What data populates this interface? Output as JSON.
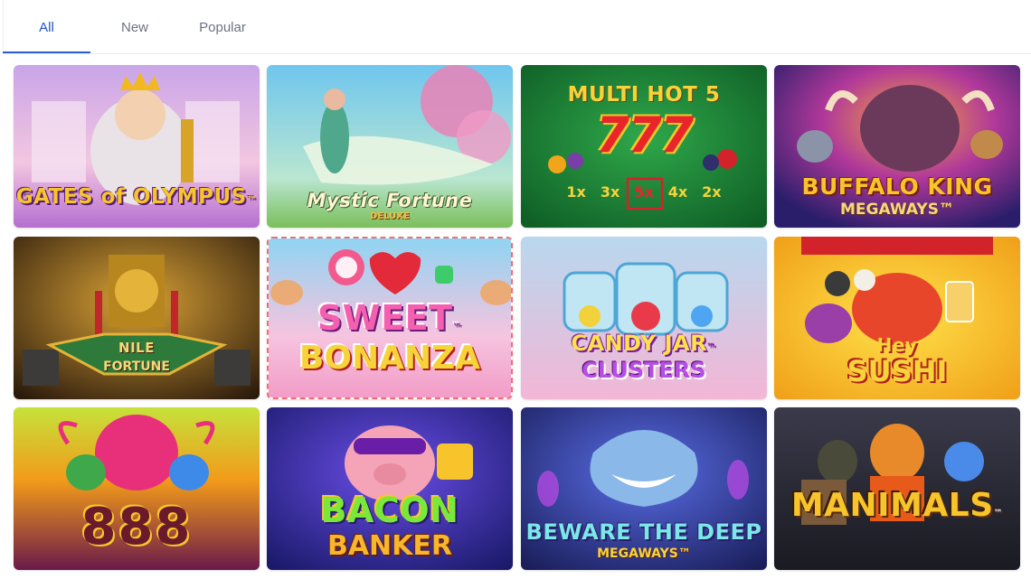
{
  "tabs": [
    {
      "label": "All",
      "active": true
    },
    {
      "label": "New",
      "active": false
    },
    {
      "label": "Popular",
      "active": false
    }
  ],
  "games": [
    {
      "title": "GATES of OLYMPUS",
      "subtitle": "",
      "badge": "™"
    },
    {
      "title": "Mystic Fortune",
      "subtitle": "DELUXE",
      "badge": ""
    },
    {
      "title": "MULTI HOT 5",
      "subtitle": "777",
      "badge": "",
      "multipliers": [
        "1x",
        "3x",
        "5x",
        "4x",
        "2x"
      ]
    },
    {
      "title": "BUFFALO KING",
      "subtitle": "MEGAWAYS™",
      "badge": ""
    },
    {
      "title": "NILE",
      "subtitle": "FORTUNE",
      "badge": ""
    },
    {
      "title": "SWEET",
      "subtitle": "BONANZA",
      "badge": "™"
    },
    {
      "title": "CANDY JAR",
      "subtitle": "CLUSTERS",
      "badge": "™"
    },
    {
      "title": "Hey",
      "subtitle": "SUSHI",
      "badge": ""
    },
    {
      "title": "888",
      "subtitle": "",
      "badge": ""
    },
    {
      "title": "BACON",
      "subtitle": "BANKER",
      "badge": ""
    },
    {
      "title": "BEWARE THE DEEP",
      "subtitle": "MEGAWAYS™",
      "badge": ""
    },
    {
      "title": "MANIMALS",
      "subtitle": "",
      "badge": "™"
    }
  ],
  "colors": {
    "accent": "#2b5fd0",
    "tab_inactive": "#6b7280"
  }
}
